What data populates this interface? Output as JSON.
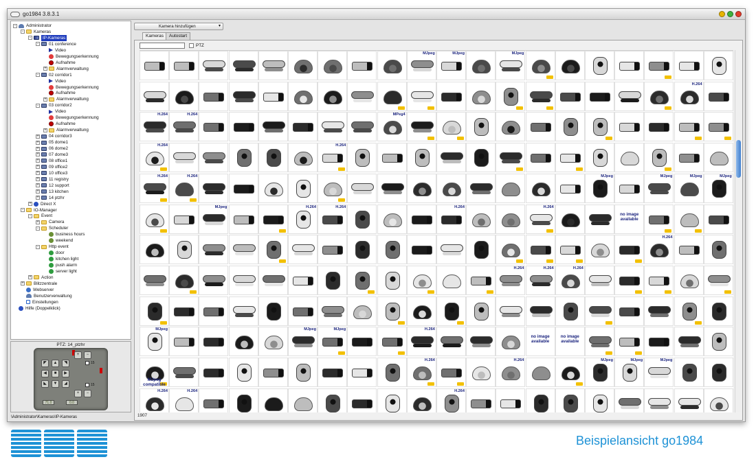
{
  "window": {
    "title": "go1984 3.8.3.1",
    "button_colors": [
      "#e8b500",
      "#3fb23c",
      "#e23b2b"
    ]
  },
  "tree": [
    {
      "label": "Administrator",
      "level": 0,
      "icon": "user-icon",
      "toggle": "-"
    },
    {
      "label": "Kameras",
      "level": 1,
      "icon": "folder-icon",
      "toggle": "-"
    },
    {
      "label": "IP-Kameras",
      "level": 2,
      "icon": "ip-cameras-icon",
      "toggle": "-",
      "selected": true
    },
    {
      "label": "01 conference",
      "level": 3,
      "icon": "camera-icon",
      "toggle": "-"
    },
    {
      "label": "Video",
      "level": 4,
      "icon": "video-icon"
    },
    {
      "label": "Bewegungserkennung",
      "level": 4,
      "icon": "motion-icon"
    },
    {
      "label": "Aufnahme",
      "level": 4,
      "icon": "record-icon"
    },
    {
      "label": "Alarmverwaltung",
      "level": 4,
      "icon": "folder-icon",
      "toggle": "+"
    },
    {
      "label": "02 corridor1",
      "level": 3,
      "icon": "camera-icon",
      "toggle": "-"
    },
    {
      "label": "Video",
      "level": 4,
      "icon": "video-icon"
    },
    {
      "label": "Bewegungserkennung",
      "level": 4,
      "icon": "motion-icon"
    },
    {
      "label": "Aufnahme",
      "level": 4,
      "icon": "record-icon"
    },
    {
      "label": "Alarmverwaltung",
      "level": 4,
      "icon": "folder-icon",
      "toggle": "+"
    },
    {
      "label": "03 corridor2",
      "level": 3,
      "icon": "camera-icon",
      "toggle": "-"
    },
    {
      "label": "Video",
      "level": 4,
      "icon": "video-icon"
    },
    {
      "label": "Bewegungserkennung",
      "level": 4,
      "icon": "motion-icon"
    },
    {
      "label": "Aufnahme",
      "level": 4,
      "icon": "record-icon"
    },
    {
      "label": "Alarmverwaltung",
      "level": 4,
      "icon": "folder-icon",
      "toggle": "+"
    },
    {
      "label": "04 corridor3",
      "level": 3,
      "icon": "camera-icon",
      "toggle": "+"
    },
    {
      "label": "05 dome1",
      "level": 3,
      "icon": "camera-icon",
      "toggle": "+"
    },
    {
      "label": "06 dome2",
      "level": 3,
      "icon": "camera-icon",
      "toggle": "+"
    },
    {
      "label": "07 dome3",
      "level": 3,
      "icon": "camera-icon",
      "toggle": "+"
    },
    {
      "label": "08 office1",
      "level": 3,
      "icon": "camera-icon",
      "toggle": "+"
    },
    {
      "label": "09 office2",
      "level": 3,
      "icon": "camera-icon",
      "toggle": "+"
    },
    {
      "label": "10 office3",
      "level": 3,
      "icon": "camera-icon",
      "toggle": "+"
    },
    {
      "label": "11 registry",
      "level": 3,
      "icon": "camera-icon",
      "toggle": "+"
    },
    {
      "label": "12 support",
      "level": 3,
      "icon": "camera-icon",
      "toggle": "+"
    },
    {
      "label": "13 kitchen",
      "level": 3,
      "icon": "camera-icon",
      "toggle": "+"
    },
    {
      "label": "14 ptzhr",
      "level": 3,
      "icon": "camera-icon",
      "toggle": "+"
    },
    {
      "label": "Direct X",
      "level": 2,
      "icon": "directx-icon",
      "toggle": "+"
    },
    {
      "label": "IO-Manager",
      "level": 1,
      "icon": "folder-icon",
      "toggle": "-"
    },
    {
      "label": "Event",
      "level": 2,
      "icon": "folder-icon",
      "toggle": "-"
    },
    {
      "label": "Camera",
      "level": 3,
      "icon": "folder-icon",
      "toggle": "+"
    },
    {
      "label": "Scheduler",
      "level": 3,
      "icon": "folder-icon",
      "toggle": "-"
    },
    {
      "label": "business hours",
      "level": 4,
      "icon": "schedule-icon"
    },
    {
      "label": "weekend",
      "level": 4,
      "icon": "schedule-icon"
    },
    {
      "label": "Http event",
      "level": 3,
      "icon": "folder-icon",
      "toggle": "-"
    },
    {
      "label": "door",
      "level": 4,
      "icon": "event-icon"
    },
    {
      "label": "kitchen light",
      "level": 4,
      "icon": "event-icon"
    },
    {
      "label": "push alarm",
      "level": 4,
      "icon": "event-icon"
    },
    {
      "label": "server light",
      "level": 4,
      "icon": "event-icon"
    },
    {
      "label": "Action",
      "level": 2,
      "icon": "folder-icon",
      "toggle": "+"
    },
    {
      "label": "Blitzzentrale",
      "level": 1,
      "icon": "folder-icon",
      "toggle": "+"
    },
    {
      "label": "Webserver",
      "level": 1,
      "icon": "globe-icon"
    },
    {
      "label": "Benutzerverwaltung",
      "level": 1,
      "icon": "users-icon"
    },
    {
      "label": "Einstellungen",
      "level": 1,
      "icon": "settings-icon"
    },
    {
      "label": "Hilfe (Doppelklick)",
      "level": 0,
      "icon": "help-icon"
    }
  ],
  "ptz": {
    "title": "PTZ: 14_ptzhr",
    "value_left": "71.0",
    "value_right": "0.0",
    "check1_label": "15",
    "check2_label": "15"
  },
  "path": "\\Administrator\\Kameras\\IP-Kameras",
  "toolbar": {
    "add_button": "Kamera hinzufügen",
    "caret": "▾"
  },
  "tabs": [
    {
      "label": "Kameras",
      "active": true
    },
    {
      "label": "Autostart",
      "active": false
    }
  ],
  "filter": {
    "search_value": "",
    "ptz_label": "PTZ"
  },
  "grid": {
    "badge_cells": [
      {
        "index": 9,
        "text": "MJpeg"
      },
      {
        "index": 10,
        "text": "MJpeg"
      },
      {
        "index": 12,
        "text": "MJpeg"
      },
      {
        "index": 38,
        "text": "H.264"
      },
      {
        "index": 40,
        "text": "H.264"
      },
      {
        "index": 41,
        "text": "H.264"
      },
      {
        "index": 48,
        "text": "MPeg4"
      },
      {
        "index": 60,
        "text": "H.264"
      },
      {
        "index": 66,
        "text": "H.264"
      },
      {
        "index": 80,
        "text": "H.264"
      },
      {
        "index": 81,
        "text": "H.264"
      },
      {
        "index": 95,
        "text": "MJpeg"
      },
      {
        "index": 97,
        "text": "MJpeg"
      },
      {
        "index": 98,
        "text": "MJpeg"
      },
      {
        "index": 99,
        "text": "MJpeg"
      },
      {
        "index": 102,
        "text": "MJpeg"
      },
      {
        "index": 105,
        "text": "H.264"
      },
      {
        "index": 106,
        "text": "H.264"
      },
      {
        "index": 110,
        "text": "H.264"
      },
      {
        "index": 113,
        "text": "H.264"
      },
      {
        "index": 137,
        "text": "H.264"
      },
      {
        "index": 152,
        "text": "H.264"
      },
      {
        "index": 153,
        "text": "H.264"
      },
      {
        "index": 154,
        "text": "H.264"
      },
      {
        "index": 180,
        "text": "MJpeg"
      },
      {
        "index": 185,
        "text": "MJpeg"
      },
      {
        "index": 186,
        "text": "MJpeg"
      },
      {
        "index": 189,
        "text": "H.264"
      },
      {
        "index": 209,
        "text": "H.264"
      },
      {
        "index": 212,
        "text": "H.264"
      },
      {
        "index": 215,
        "text": "MJpeg"
      },
      {
        "index": 216,
        "text": "MJpeg"
      },
      {
        "index": 217,
        "text": "MJpeg"
      },
      {
        "index": 220,
        "text": "H.264"
      },
      {
        "index": 221,
        "text": "H.264"
      },
      {
        "index": 230,
        "text": "H.264"
      }
    ],
    "no_image_cells": [
      {
        "index": 116,
        "text": "no image available"
      },
      {
        "index": 193,
        "text": "no image available"
      },
      {
        "index": 194,
        "text": "no image available"
      }
    ],
    "text_cells": [
      {
        "index": 200,
        "text": "MJpeg compatible"
      }
    ],
    "count": "1907"
  },
  "branding": {
    "logo": "SBH",
    "tagline": "Beispielansicht go1984",
    "brand_color": "#1e92d6"
  }
}
